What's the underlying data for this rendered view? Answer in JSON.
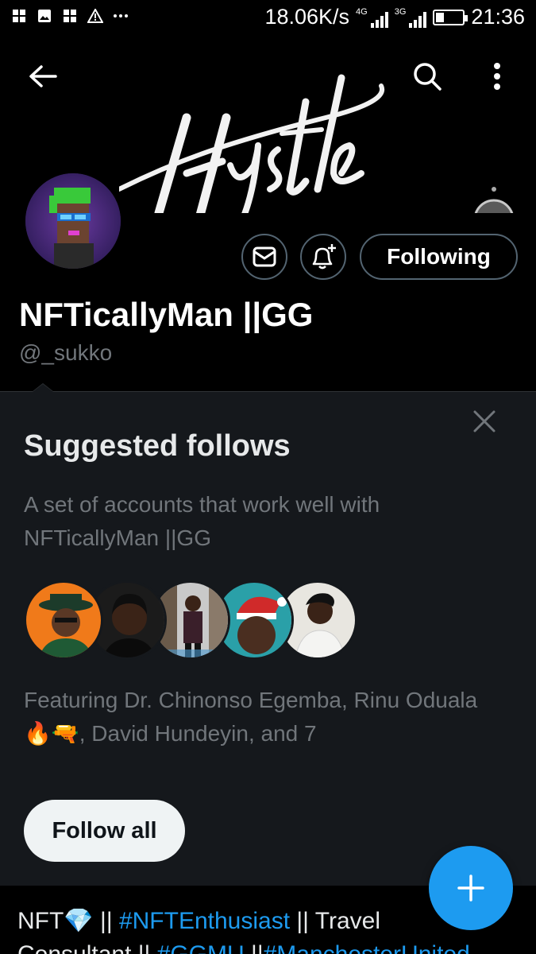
{
  "status_bar": {
    "speed": "18.06K/s",
    "sim1_label": "4G",
    "sim2_label": "3G",
    "battery_level": 0.3,
    "time": "21:36"
  },
  "banner": {
    "wordmark": "Hustle"
  },
  "profile": {
    "display_name": "NFTicallyMan ||GG",
    "handle": "@_sukko",
    "following_label": "Following"
  },
  "suggested": {
    "title": "Suggested follows",
    "description": "A set of accounts that work well with NFTicallyMan ||GG",
    "featuring_prefix": "Featuring Dr. Chinonso Egemba, Rinu Oduala ",
    "featuring_emoji": "🔥🔫",
    "featuring_suffix": ", David Hundeyin, and 7",
    "follow_all_label": "Follow all"
  },
  "bio": {
    "part1": "NFT",
    "emoji": "💎",
    "part2": " || ",
    "tag1": "#NFTEnthusiast",
    "part3": " || Travel",
    "line2_a": "Consultant || ",
    "tag2": "#GGMU",
    "line2_b": " ||",
    "tag3": "#ManchesterUnited"
  },
  "colors": {
    "accent": "#1d9bf0",
    "card_bg": "#15181c",
    "muted": "#71767b"
  },
  "icons": [
    "back-arrow-icon",
    "search-icon",
    "more-vertical-icon",
    "mail-icon",
    "bell-plus-icon",
    "close-icon",
    "plus-icon",
    "battery-icon",
    "signal-icon"
  ]
}
